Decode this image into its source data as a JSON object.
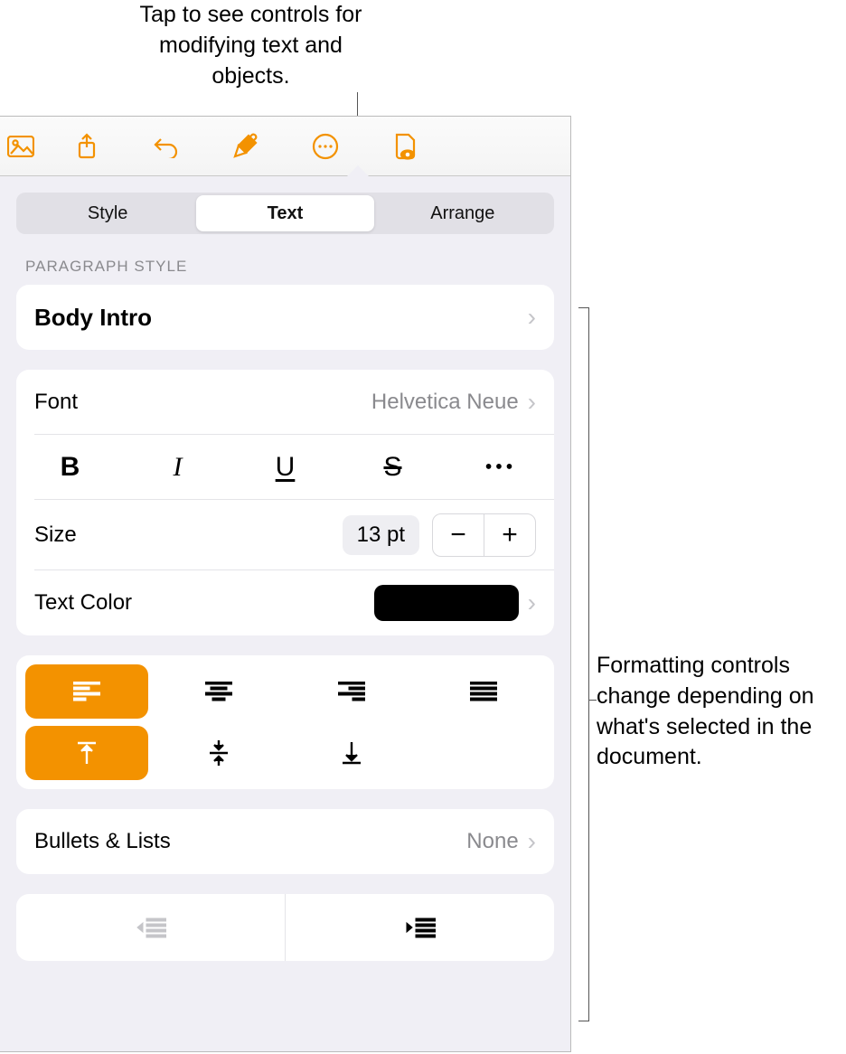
{
  "callouts": {
    "top": "Tap to see controls for modifying text and objects.",
    "right": "Formatting controls change depending on what's selected in the document."
  },
  "toolbar": {
    "icons": [
      "insert",
      "share",
      "undo",
      "format",
      "more",
      "view"
    ]
  },
  "tabs": {
    "items": [
      "Style",
      "Text",
      "Arrange"
    ],
    "selected_index": 1
  },
  "paragraph": {
    "section_label": "PARAGRAPH STYLE",
    "style_name": "Body Intro"
  },
  "font": {
    "label": "Font",
    "value": "Helvetica Neue",
    "format_buttons": [
      "B",
      "I",
      "U",
      "S",
      "•••"
    ],
    "size_label": "Size",
    "size_value": "13 pt",
    "color_label": "Text Color",
    "color_hex": "#000000"
  },
  "alignment": {
    "horizontal": [
      "left",
      "center",
      "right",
      "justify"
    ],
    "horizontal_selected": "left",
    "vertical": [
      "top",
      "middle",
      "bottom"
    ],
    "vertical_selected": "top"
  },
  "bullets": {
    "label": "Bullets & Lists",
    "value": "None"
  },
  "indent": {
    "outdent_enabled": false,
    "indent_enabled": true
  },
  "accent_color": "#f39200"
}
